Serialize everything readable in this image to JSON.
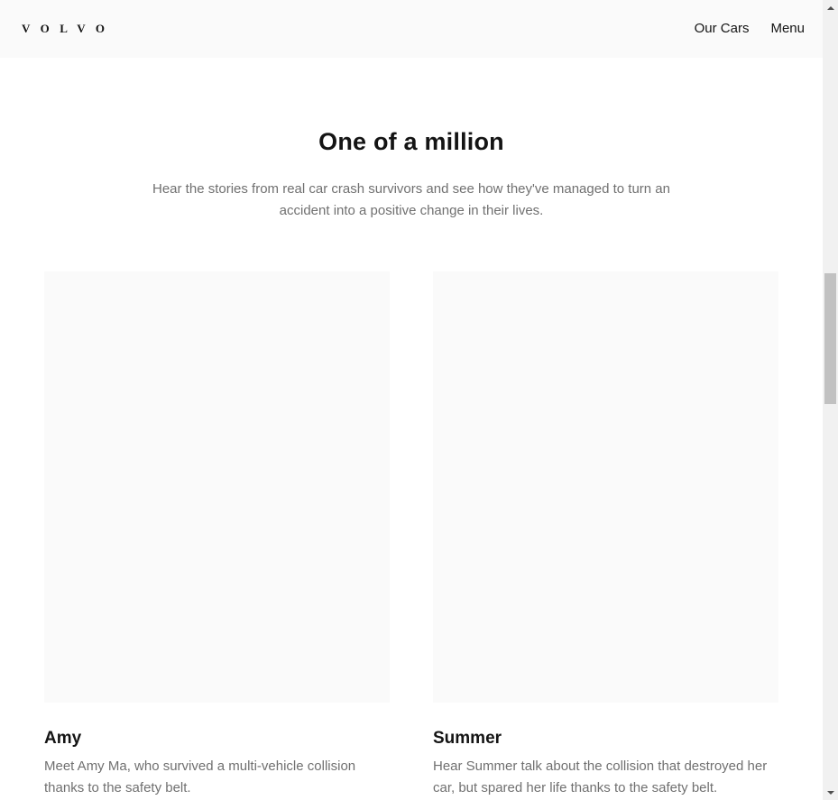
{
  "header": {
    "logo": "VOLVO",
    "nav": [
      {
        "label": "Our Cars"
      },
      {
        "label": "Menu"
      }
    ]
  },
  "intro": {
    "title": "One of a million",
    "text": "Hear the stories from real car crash survivors and see how they've managed to turn an accident into a positive change in their lives."
  },
  "stories": [
    {
      "name": "Amy",
      "text": "Meet Amy Ma, who survived a multi-vehicle collision thanks to the safety belt."
    },
    {
      "name": "Summer",
      "text": "Hear Summer talk about the collision that destroyed her car, but spared her life thanks to the safety belt."
    }
  ],
  "colors": {
    "header_bg": "#fafafa",
    "text_primary": "#141414",
    "text_secondary": "#707070",
    "media_placeholder": "#fafafa"
  }
}
